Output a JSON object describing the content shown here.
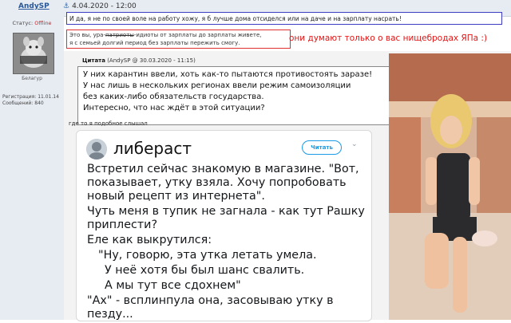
{
  "header": {
    "username": "AndySP",
    "date": "4.04.2020 - 12:00",
    "date_icon": "anchor-icon"
  },
  "profile": {
    "status_label": "Статус:",
    "status_value": "Offline",
    "nickname": "Белагур",
    "reg_label": "Регистрация:",
    "reg_value": "11.01.14",
    "msgs_label": "Сообщений:",
    "msgs_value": "840"
  },
  "post": {
    "line1": "И да, я не по своей воле на работу хожу, я б лучше дома отсиделся или на даче и на зарплату насрать!",
    "line2_part1": "Это вы, ура-",
    "line2_strike": "патриоты",
    "line2_part2": "-идиоты от зарплаты до зарплаты живете,",
    "line3": "я с семьей долгий период без зарплаты пережить смогу.",
    "red_note": "они думают только о вас нищебродах ЯПа :)"
  },
  "quote": {
    "label": "Цитата",
    "meta": "(AndySP @ 30.03.2020 - 11:15)",
    "lines": [
      "У них карантин ввели, хоть как-то пытаются противостоять заразе!",
      "У нас лишь в нескольких регионах ввели режим самоизоляции",
      "без каких-либо обязательств государства.",
      "Интересно, что нас ждёт в этой ситуации?"
    ]
  },
  "where_text": "где то я подобное слышал",
  "tweet": {
    "name": "либераст",
    "follow_label": "Читать",
    "lines": [
      "Встретил сейчас знакомую в магазине. \"Вот, показывает, утку взяла. Хочу попробовать новый рецепт из интернета\".",
      "Чуть меня в тупик не загнала - как тут Рашку приплести?",
      "Еле как выкрутился:",
      "\"Ну, говорю, эта утка летать умела.",
      "У неё хотя бы был шанс свалить.",
      "А мы тут все сдохнем\"",
      "\"Ах\" - всплинпула она, засовываю утку в пезду..."
    ]
  }
}
